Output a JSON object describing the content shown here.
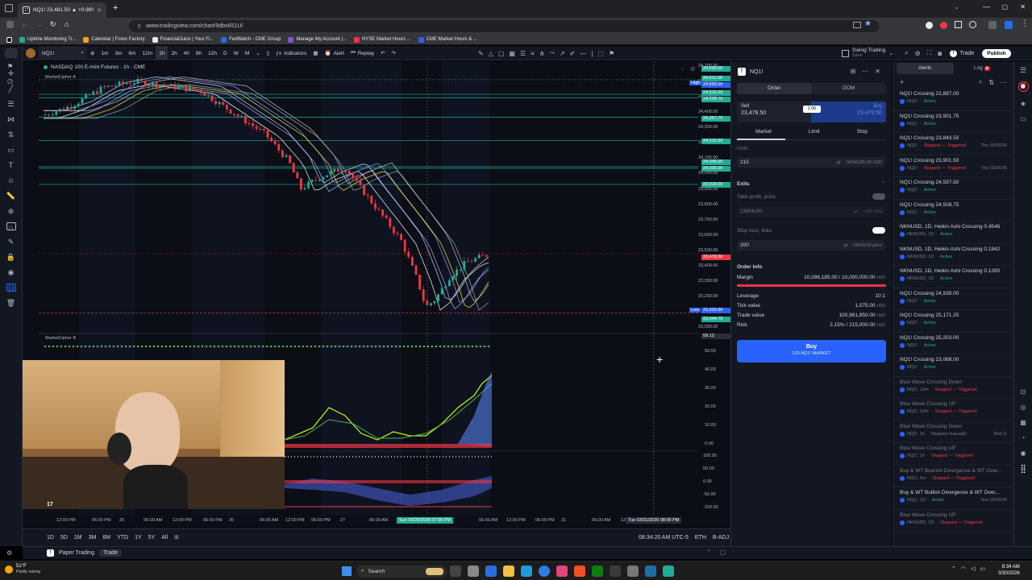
{
  "browser": {
    "tab_title": "NQ1! 23,481.50 ▲ +0.98% Swi",
    "url": "www.tradingview.com/chart/9dbx651U/",
    "bookmarks": [
      "Uptime Monitoring Tr...",
      "Calendar | Forex Factory",
      "FinancialJuice | Your Fi...",
      "FedWatch - CME Group",
      "Manage My Account |...",
      "NYSE Market Hours ...",
      "CME Market Hours & ..."
    ]
  },
  "toolbar": {
    "symbol": "NQ1!",
    "intervals": [
      "1m",
      "3m",
      "6m",
      "12m",
      "1h",
      "2h",
      "4h",
      "8h",
      "12h",
      "D",
      "W",
      "M"
    ],
    "indicators_label": "Indicators",
    "alert_label": "Alert",
    "replay_label": "Replay",
    "layout_name": "Swing Trading",
    "layout_sub": "Save",
    "trade_label": "Trade",
    "publish_label": "Publish"
  },
  "chart": {
    "title": "NASDAQ 100 E-mini Futures · 1h · CME",
    "indicator_a": "MarketCipher A",
    "indicator_b": "MarketCipher B",
    "price_ticks": [
      "24,700.00",
      "24,600.00",
      "24,500.00",
      "24,400.00",
      "24,300.00",
      "24,200.00",
      "24,100.00",
      "24,000.00",
      "23,900.00",
      "23,800.00",
      "23,700.00",
      "23,600.00",
      "23,500.00",
      "23,400.00",
      "23,300.00",
      "23,200.00",
      "23,100.00",
      "23,000.00"
    ],
    "osc_ticks_1": [
      "50.00",
      "40.00",
      "30.00",
      "20.00",
      "10.00",
      "0.00"
    ],
    "osc_ticks_2": [
      "100.00",
      "50.00",
      "0.00",
      "-50.00",
      "-100.00"
    ],
    "level_labels": [
      {
        "text": "24,699.00",
        "color": "#22ab94"
      },
      {
        "text": "24,611.50",
        "color": "#22ab94"
      },
      {
        "text": "24,550.00",
        "color": "#2962ff"
      },
      {
        "text": "24,516.25",
        "color": "#22ab94"
      },
      {
        "text": "24,494.75",
        "color": "#22ab94"
      },
      {
        "text": "24,367.75",
        "color": "#22ab94"
      },
      {
        "text": "24,215.50",
        "color": "#22ab94"
      },
      {
        "text": "24,045.00",
        "color": "#22ab94"
      },
      {
        "text": "24,035.00",
        "color": "#22ab94"
      },
      {
        "text": "23,929.00",
        "color": "#22ab94"
      },
      {
        "text": "23,478.50",
        "color": "#f23645"
      },
      {
        "text": "23,093.00",
        "color": "#2962ff"
      },
      {
        "text": "23,044.75",
        "color": "#22ab94"
      },
      {
        "text": "59.13",
        "color": "#2a2e39"
      }
    ],
    "high_label": "High",
    "low_label": "Low",
    "time_labels": [
      "12:00 PM",
      "06:00 PM",
      "25",
      "06:00 AM",
      "12:00 PM",
      "06:00 PM",
      "26",
      "06:00 AM",
      "12:00 PM",
      "06:00 PM",
      "27",
      "06:00 AM",
      "11:00 PM",
      "06:00 AM",
      "12:00 PM",
      "06:00 PM",
      "31",
      "06:00 AM",
      "12:00"
    ],
    "crosshair_time": "Sun 03/29/2026  07:00 PM",
    "crosshair_time2": "Tue 03/31/2026  08:00 PM",
    "ranges": [
      "1D",
      "5D",
      "1M",
      "3M",
      "6M",
      "YTD",
      "1Y",
      "5Y",
      "All"
    ],
    "clock": "08:34:20 AM UTC-5",
    "session": "ETH",
    "adj": "B-ADJ"
  },
  "order_panel": {
    "symbol": "NQ1!",
    "tab_order": "Order",
    "tab_dom": "DOM",
    "sell_label": "Sell",
    "sell_price": "23,478.50",
    "qty": "1.00",
    "buy_label": "Buy",
    "buy_price": "23,479.50",
    "order_types": [
      "Market",
      "Limit",
      "Stop"
    ],
    "units_label": "Units",
    "units_value": "215",
    "units_right": "10096185.00 USD",
    "exits_label": "Exits",
    "tp_label": "Take profit, price",
    "tp_value": "23406.00",
    "tp_right": "-438 ticks",
    "sl_label": "Stop loss, ticks",
    "sl_value": "200",
    "sl_right": "23429.50 price",
    "order_info_label": "Order info",
    "margin_label": "Margin",
    "margin_value": "10,096,185.00 / 10,000,000.00",
    "margin_fill_pct": 100,
    "leverage_label": "Leverage",
    "leverage_value": "10:1",
    "tick_label": "Tick value",
    "tick_value": "1,075.00",
    "trade_value_label": "Trade value",
    "trade_value": "100,961,850.00",
    "risk_label": "Risk",
    "risk_value": "2.15% / 215,000.00",
    "currency": "USD",
    "buy_button": "Buy",
    "buy_button_sub": "215 NQ1! MARKET"
  },
  "alerts_panel": {
    "tab_alerts": "Alerts",
    "tab_log": "Log",
    "items": [
      {
        "title": "NQ1! Crossing 22,887.00",
        "sym": "NQ1!",
        "status": "Active",
        "status_color": "#22ab94",
        "date": ""
      },
      {
        "title": "NQ1! Crossing 23,901.75",
        "sym": "NQ1!",
        "status": "Active",
        "status_color": "#22ab94",
        "date": ""
      },
      {
        "title": "NQ1! Crossing 23,843.50",
        "sym": "NQ1!",
        "status": "Stopped — Triggered",
        "status_color": "#f23645",
        "date": "Thu 03/26/26"
      },
      {
        "title": "NQ1! Crossing 23,901.50",
        "sym": "NQ1!",
        "status": "Stopped — Triggered",
        "status_color": "#f23645",
        "date": "Thu 03/26/26"
      },
      {
        "title": "NQ1! Crossing 24,597.50",
        "sym": "NQ1!",
        "status": "Active",
        "status_color": "#22ab94",
        "date": ""
      },
      {
        "title": "NQ1! Crossing 24,508.75",
        "sym": "NQ1!",
        "status": "Active",
        "status_color": "#22ab94",
        "date": ""
      },
      {
        "title": "NKNUSD, 1D, Heikin Ashi Crossing 0.4546",
        "sym": "NKNUSD, 1D",
        "status": "Active",
        "status_color": "#22ab94",
        "date": ""
      },
      {
        "title": "NKNUSD, 1D, Heikin Ashi Crossing 0.1842",
        "sym": "NKNUSD, 1D",
        "status": "Active",
        "status_color": "#22ab94",
        "date": ""
      },
      {
        "title": "NKNUSD, 1D, Heikin Ashi Crossing 0.1280",
        "sym": "NKNUSD, 1D",
        "status": "Active",
        "status_color": "#22ab94",
        "date": ""
      },
      {
        "title": "NQ1! Crossing 24,939.00",
        "sym": "NQ1!",
        "status": "Active",
        "status_color": "#22ab94",
        "date": ""
      },
      {
        "title": "NQ1! Crossing 25,171.25",
        "sym": "NQ1!",
        "status": "Active",
        "status_color": "#22ab94",
        "date": ""
      },
      {
        "title": "NQ1! Crossing 25,203.00",
        "sym": "NQ1!",
        "status": "Active",
        "status_color": "#22ab94",
        "date": ""
      },
      {
        "title": "NQ1! Crossing 23,068.00",
        "sym": "NQ1!",
        "status": "Active",
        "status_color": "#22ab94",
        "date": ""
      },
      {
        "title": "Blue Wave Crossing Down",
        "sym": "NQ1!, 12m",
        "status": "Stopped — Triggered",
        "status_color": "#f23645",
        "date": "",
        "dim": true
      },
      {
        "title": "Blue Wave Crossing UP",
        "sym": "NQ1!, 12m",
        "status": "Stopped — Triggered",
        "status_color": "#f23645",
        "date": "",
        "dim": true
      },
      {
        "title": "Blue Wave Crossing Down",
        "sym": "NQ1!, 1h",
        "status": "Stopped manually",
        "status_color": "#787b86",
        "date": "Mon C",
        "dim": true
      },
      {
        "title": "Blue Wave Crossing UP",
        "sym": "NQ1!, 1h",
        "status": "Stopped — Triggered",
        "status_color": "#f23645",
        "date": "",
        "dim": true
      },
      {
        "title": "Buy & WT Bearish Divergence & WT Over...",
        "sym": "NQ1!, 5m",
        "status": "Stopped — Triggered",
        "status_color": "#f23645",
        "date": "",
        "dim": true
      },
      {
        "title": "Buy & WT Bullish Divergence & WT Over...",
        "sym": "NQ1!, 1D",
        "status": "Active",
        "status_color": "#22ab94",
        "date": "Sun 03/29/26"
      },
      {
        "title": "Blue Wave Crossing UP",
        "sym": "NKNUSD, 1D",
        "status": "Stopped — Triggered",
        "status_color": "#f23645",
        "date": "",
        "dim": true
      }
    ]
  },
  "status_bar": {
    "paper": "Paper Trading",
    "trade": "Trade"
  },
  "taskbar": {
    "weather_temp": "51°F",
    "weather_desc": "Partly sunny",
    "search": "Search",
    "time": "8:34 AM",
    "date": "3/30/2026"
  }
}
